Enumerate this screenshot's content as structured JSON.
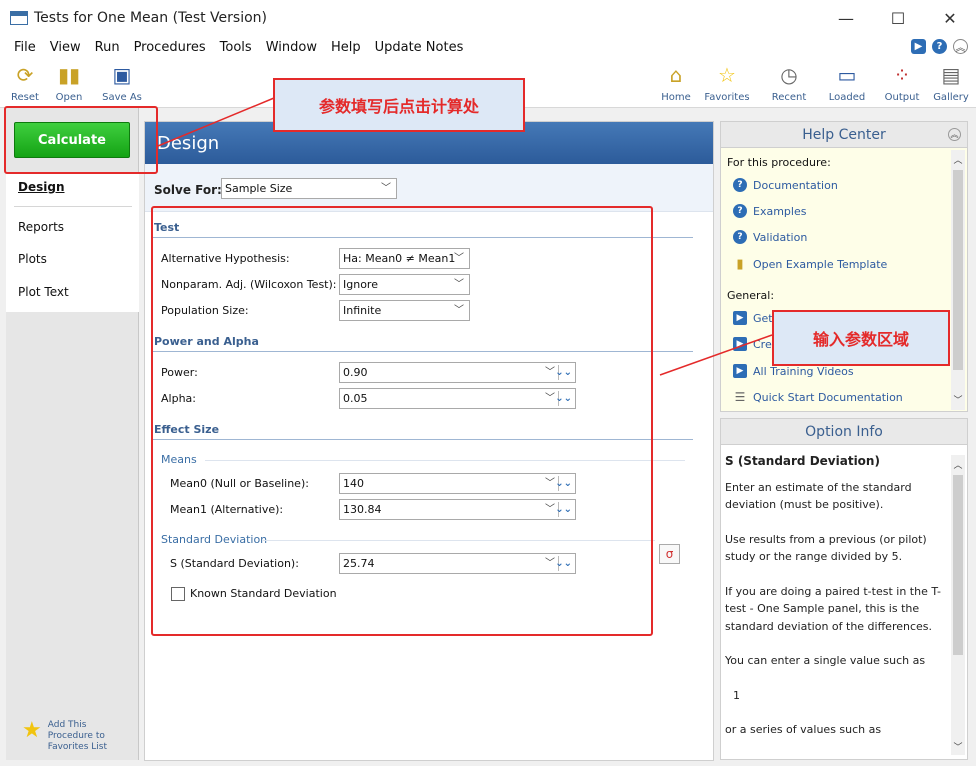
{
  "window": {
    "title": "Tests for One Mean (Test Version)",
    "minimize": "—",
    "maximize": "☐",
    "close": "✕"
  },
  "menu": [
    "File",
    "View",
    "Run",
    "Procedures",
    "Tools",
    "Window",
    "Help",
    "Update Notes"
  ],
  "toolbar": {
    "left": [
      {
        "label": "Reset",
        "icon": "reset-icon"
      },
      {
        "label": "Open",
        "icon": "open-icon"
      },
      {
        "label": "Save As",
        "icon": "save-icon"
      }
    ],
    "right": [
      {
        "label": "Home",
        "icon": "home-icon"
      },
      {
        "label": "Favorites",
        "icon": "star-icon"
      },
      {
        "label": "Recent",
        "icon": "clock-icon"
      },
      {
        "label": "Loaded",
        "icon": "window-icon"
      },
      {
        "label": "Output",
        "icon": "chart-icon"
      },
      {
        "label": "Gallery",
        "icon": "gallery-icon"
      }
    ]
  },
  "left_panel": {
    "calculate": "Calculate",
    "tabs": [
      "Design",
      "Reports",
      "Plots",
      "Plot Text"
    ],
    "favorites": "Add This Procedure to Favorites List"
  },
  "design": {
    "header": "Design",
    "solve_for_label": "Solve For:",
    "solve_for_value": "Sample Size",
    "sections": {
      "test": "Test",
      "power_alpha": "Power and Alpha",
      "effect_size": "Effect Size",
      "means": "Means",
      "std_dev": "Standard Deviation"
    },
    "fields": {
      "alt_hyp_label": "Alternative Hypothesis:",
      "alt_hyp_value": "Ha: Mean0 ≠ Mean1",
      "nonparam_label": "Nonparam. Adj. (Wilcoxon Test):",
      "nonparam_value": "Ignore",
      "pop_size_label": "Population Size:",
      "pop_size_value": "Infinite",
      "power_label": "Power:",
      "power_value": "0.90",
      "alpha_label": "Alpha:",
      "alpha_value": "0.05",
      "mean0_label": "Mean0 (Null or Baseline):",
      "mean0_value": "140",
      "mean1_label": "Mean1 (Alternative):",
      "mean1_value": "130.84",
      "s_label": "S (Standard Deviation):",
      "s_value": "25.74",
      "known_sd_label": "Known Standard Deviation"
    }
  },
  "help_center": {
    "title": "Help Center",
    "for_procedure": "For this procedure:",
    "links": [
      "Documentation",
      "Examples",
      "Validation",
      "Open Example Template"
    ],
    "general": "General:",
    "general_links": [
      "Getting Started",
      "Creating Your First Report",
      "All Training Videos",
      "Quick Start Documentation"
    ],
    "general_visible": [
      "Gett",
      "Crea",
      "All Training Videos",
      "Quick Start Documentation"
    ]
  },
  "option_info": {
    "title": "Option Info",
    "heading": "S (Standard Deviation)",
    "paragraphs": [
      "Enter an estimate of the standard deviation (must be positive).",
      "Use results from a previous (or pilot) study or the range divided by 5.",
      "If you are doing a paired t-test in the T-test - One Sample panel, this is the standard deviation of the differences.",
      "You can enter a single value such as",
      "1",
      "or a series of values such as"
    ]
  },
  "annotations": {
    "calc_note": "参数填写后点击计算处",
    "input_note": "输入参数区域"
  },
  "colors": {
    "accent": "#2c5b9a",
    "calculate": "#14a314",
    "annotation": "#e42a2a"
  }
}
